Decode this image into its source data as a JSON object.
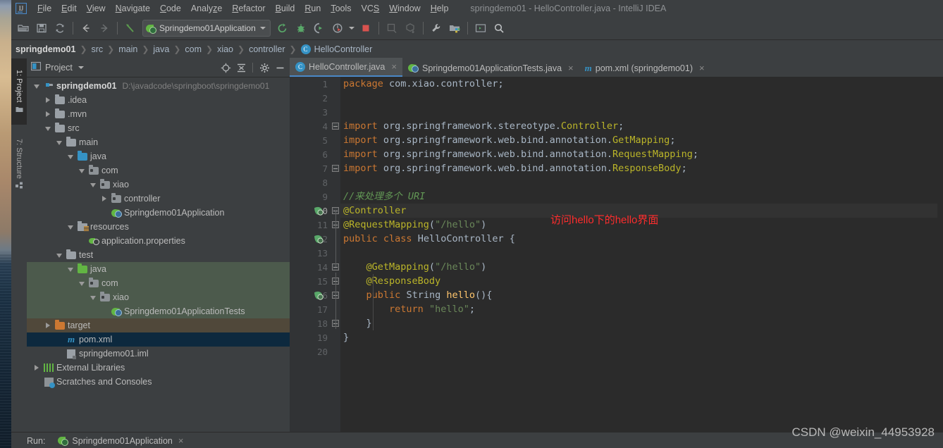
{
  "window": {
    "title": "springdemo01 - HelloController.java - IntelliJ IDEA"
  },
  "menubar": {
    "logo_icon": "intellij-idea-logo-icon",
    "items": [
      {
        "label": "File",
        "mnemonic": "F"
      },
      {
        "label": "Edit",
        "mnemonic": "E"
      },
      {
        "label": "View",
        "mnemonic": "V"
      },
      {
        "label": "Navigate",
        "mnemonic": "N"
      },
      {
        "label": "Code",
        "mnemonic": "C"
      },
      {
        "label": "Analyze",
        "mnemonic": "z"
      },
      {
        "label": "Refactor",
        "mnemonic": "R"
      },
      {
        "label": "Build",
        "mnemonic": "B"
      },
      {
        "label": "Run",
        "mnemonic": "R"
      },
      {
        "label": "Tools",
        "mnemonic": "T"
      },
      {
        "label": "VCS",
        "mnemonic": "S"
      },
      {
        "label": "Window",
        "mnemonic": "W"
      },
      {
        "label": "Help",
        "mnemonic": "H"
      }
    ]
  },
  "toolbar": {
    "open_label": "Open",
    "save_label": "Save All",
    "sync_label": "Synchronize",
    "back_label": "Back",
    "forward_label": "Forward",
    "undo_label": "Undo",
    "run_config": "Springdemo01Application",
    "run_label": "Run",
    "debug_label": "Debug",
    "run_coverage_label": "Run with Coverage",
    "profile_label": "Profile",
    "stop_label": "Stop",
    "update_label": "Update Project",
    "commit_label": "Commit",
    "settings_label": "Settings",
    "structure_label": "Project Structure",
    "terminal_label": "Terminal",
    "search_label": "Search Everywhere"
  },
  "breadcrumb": {
    "items": [
      "springdemo01",
      "src",
      "main",
      "java",
      "com",
      "xiao",
      "controller",
      "HelloController"
    ],
    "last_icon": "java-class-icon"
  },
  "stripe": {
    "tabs": [
      {
        "label": "1: Project",
        "icon": "project-icon",
        "active": true
      },
      {
        "label": "7: Structure",
        "icon": "structure-icon",
        "active": false
      }
    ]
  },
  "project_panel": {
    "title": "Project",
    "actions": [
      {
        "name": "locate-icon",
        "label": "Select Opened File"
      },
      {
        "name": "collapse-all-icon",
        "label": "Collapse All"
      },
      {
        "name": "gear-icon",
        "label": "Settings"
      },
      {
        "name": "hide-icon",
        "label": "Hide"
      }
    ],
    "tree": [
      {
        "label": "springdemo01",
        "path": "D:\\javadcode\\springboot\\springdemo01",
        "indent": 0,
        "arrow": "open",
        "icon": "module-folder-icon",
        "bold": true,
        "tint": "none"
      },
      {
        "label": ".idea",
        "indent": 1,
        "arrow": "closed",
        "icon": "folder-icon",
        "tint": "none"
      },
      {
        "label": ".mvn",
        "indent": 1,
        "arrow": "closed",
        "icon": "folder-icon",
        "tint": "none"
      },
      {
        "label": "src",
        "indent": 1,
        "arrow": "open",
        "icon": "folder-icon",
        "tint": "none"
      },
      {
        "label": "main",
        "indent": 2,
        "arrow": "open",
        "icon": "folder-icon",
        "tint": "none"
      },
      {
        "label": "java",
        "indent": 3,
        "arrow": "open",
        "icon": "source-root-folder-icon",
        "tint": "none"
      },
      {
        "label": "com",
        "indent": 4,
        "arrow": "open",
        "icon": "package-icon",
        "tint": "none"
      },
      {
        "label": "xiao",
        "indent": 5,
        "arrow": "open",
        "icon": "package-icon",
        "tint": "none"
      },
      {
        "label": "controller",
        "indent": 6,
        "arrow": "closed",
        "icon": "package-icon",
        "tint": "none"
      },
      {
        "label": "Springdemo01Application",
        "indent": 6,
        "arrow": "none",
        "icon": "spring-boot-class-icon",
        "tint": "none"
      },
      {
        "label": "resources",
        "indent": 3,
        "arrow": "open",
        "icon": "resource-root-folder-icon",
        "tint": "none"
      },
      {
        "label": "application.properties",
        "indent": 4,
        "arrow": "none",
        "icon": "spring-properties-icon",
        "tint": "none"
      },
      {
        "label": "test",
        "indent": 2,
        "arrow": "open",
        "icon": "folder-icon",
        "tint": "none"
      },
      {
        "label": "java",
        "indent": 3,
        "arrow": "open",
        "icon": "test-source-root-folder-icon",
        "tint": "green"
      },
      {
        "label": "com",
        "indent": 4,
        "arrow": "open",
        "icon": "package-icon",
        "tint": "green"
      },
      {
        "label": "xiao",
        "indent": 5,
        "arrow": "open",
        "icon": "package-icon",
        "tint": "green"
      },
      {
        "label": "Springdemo01ApplicationTests",
        "indent": 6,
        "arrow": "none",
        "icon": "spring-test-class-icon",
        "tint": "green"
      },
      {
        "label": "target",
        "indent": 1,
        "arrow": "closed",
        "icon": "excluded-folder-icon",
        "tint": "brown"
      },
      {
        "label": "pom.xml",
        "indent": 2,
        "arrow": "none",
        "icon": "maven-file-icon",
        "tint": "selected"
      },
      {
        "label": "springdemo01.iml",
        "indent": 2,
        "arrow": "none",
        "icon": "iml-file-icon",
        "tint": "none"
      },
      {
        "label": "External Libraries",
        "indent": 0,
        "arrow": "closed",
        "icon": "libraries-icon",
        "tint": "none"
      },
      {
        "label": "Scratches and Consoles",
        "indent": 0,
        "arrow": "none",
        "icon": "scratches-icon",
        "tint": "none"
      }
    ]
  },
  "editor_tabs": [
    {
      "label": "HelloController.java",
      "icon": "java-class-icon",
      "active": true,
      "close": "×"
    },
    {
      "label": "Springdemo01ApplicationTests.java",
      "icon": "spring-test-class-icon",
      "active": false,
      "close": "×"
    },
    {
      "label": "pom.xml (springdemo01)",
      "icon": "maven-file-icon",
      "active": false,
      "close": "×"
    }
  ],
  "editor": {
    "filename": "HelloController.java",
    "line_numbers": [
      1,
      2,
      3,
      4,
      5,
      6,
      7,
      8,
      9,
      10,
      11,
      12,
      13,
      14,
      15,
      16,
      17,
      18,
      19,
      20
    ],
    "gutter_marks": [
      {
        "line": 10,
        "icon": "spring-bean-gutter-icon"
      },
      {
        "line": 12,
        "icon": "spring-bean-class-gutter-icon"
      },
      {
        "line": 16,
        "icon": "spring-mapping-gutter-icon"
      }
    ],
    "highlighted_line": 10,
    "lines": [
      {
        "n": 1,
        "text": "package com.xiao.controller;"
      },
      {
        "n": 2,
        "text": ""
      },
      {
        "n": 3,
        "text": ""
      },
      {
        "n": 4,
        "text": "import org.springframework.stereotype.Controller;"
      },
      {
        "n": 5,
        "text": "import org.springframework.web.bind.annotation.GetMapping;"
      },
      {
        "n": 6,
        "text": "import org.springframework.web.bind.annotation.RequestMapping;"
      },
      {
        "n": 7,
        "text": "import org.springframework.web.bind.annotation.ResponseBody;"
      },
      {
        "n": 8,
        "text": ""
      },
      {
        "n": 9,
        "text": "//来处理多个 URI"
      },
      {
        "n": 10,
        "text": "@Controller"
      },
      {
        "n": 11,
        "text": "@RequestMapping(\"/hello\")"
      },
      {
        "n": 12,
        "text": "public class HelloController {"
      },
      {
        "n": 13,
        "text": ""
      },
      {
        "n": 14,
        "text": "    @GetMapping(\"/hello\")"
      },
      {
        "n": 15,
        "text": "    @ResponseBody"
      },
      {
        "n": 16,
        "text": "    public String hello(){"
      },
      {
        "n": 17,
        "text": "        return \"hello\";"
      },
      {
        "n": 18,
        "text": "    }"
      },
      {
        "n": 19,
        "text": "}"
      },
      {
        "n": 20,
        "text": ""
      }
    ],
    "annotation_red": "访问hello下的hello界面"
  },
  "run_bar": {
    "label": "Run:",
    "config_name": "Springdemo01Application",
    "icon": "spring-boot-run-icon",
    "close": "×"
  },
  "watermark": "CSDN @weixin_44953928",
  "colors": {
    "bg": "#3c3f41",
    "editor_bg": "#2b2b2b",
    "gutter_bg": "#313335",
    "keyword": "#cc7832",
    "annotation": "#bbb529",
    "string": "#6a8759",
    "comment": "#629755",
    "method": "#ffc66d",
    "text": "#a9b7c6",
    "accent_blue": "#3592c4",
    "selection": "#0d293e",
    "annotation_red": "#ff2d2d"
  }
}
